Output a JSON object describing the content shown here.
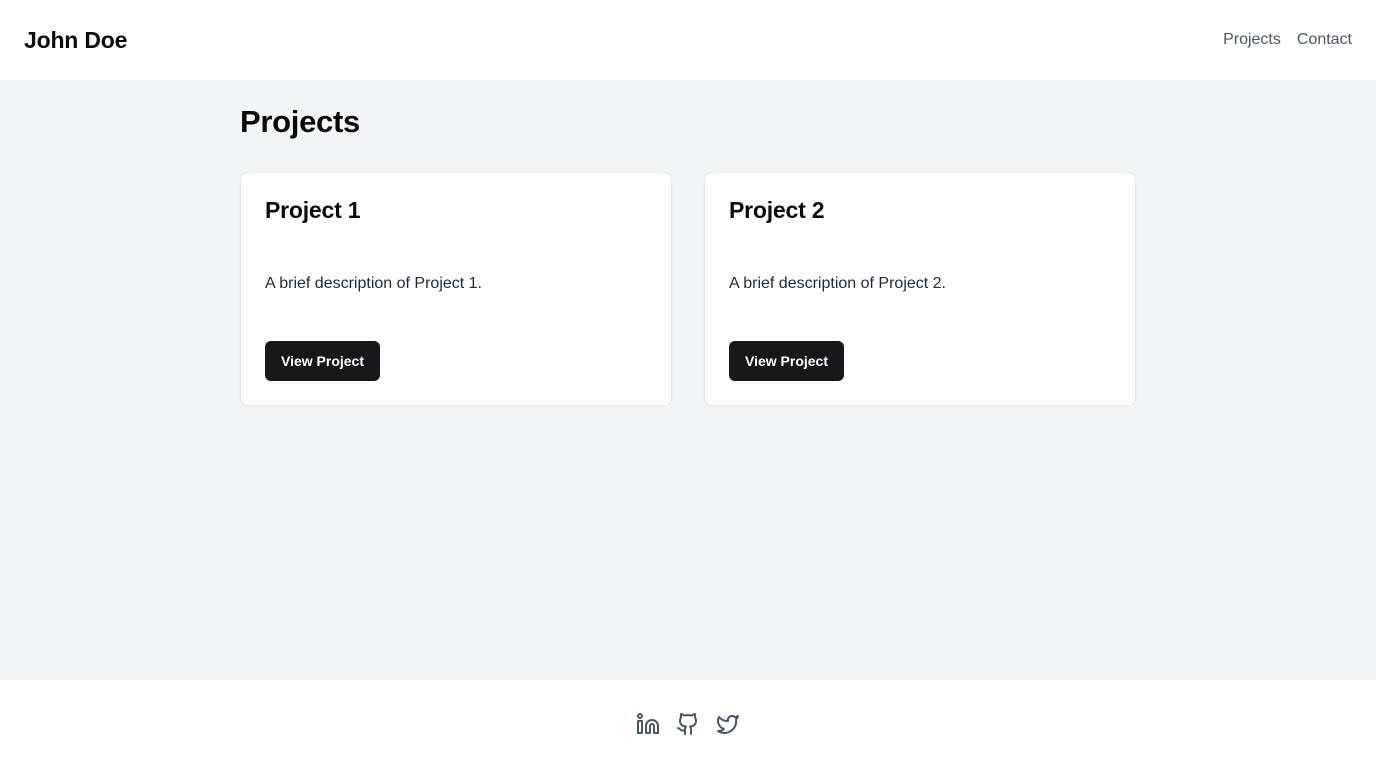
{
  "header": {
    "brand": "John Doe",
    "nav": [
      {
        "label": "Projects"
      },
      {
        "label": "Contact"
      }
    ]
  },
  "main": {
    "title": "Projects",
    "projects": [
      {
        "title": "Project 1",
        "description": "A brief description of Project 1.",
        "button_label": "View Project"
      },
      {
        "title": "Project 2",
        "description": "A brief description of Project 2.",
        "button_label": "View Project"
      }
    ]
  },
  "footer": {
    "icons": [
      "linkedin-icon",
      "github-icon",
      "twitter-icon"
    ]
  },
  "colors": {
    "background": "#f3f4f6",
    "surface": "#ffffff",
    "button": "#18181b",
    "muted_text": "#4b5563"
  }
}
